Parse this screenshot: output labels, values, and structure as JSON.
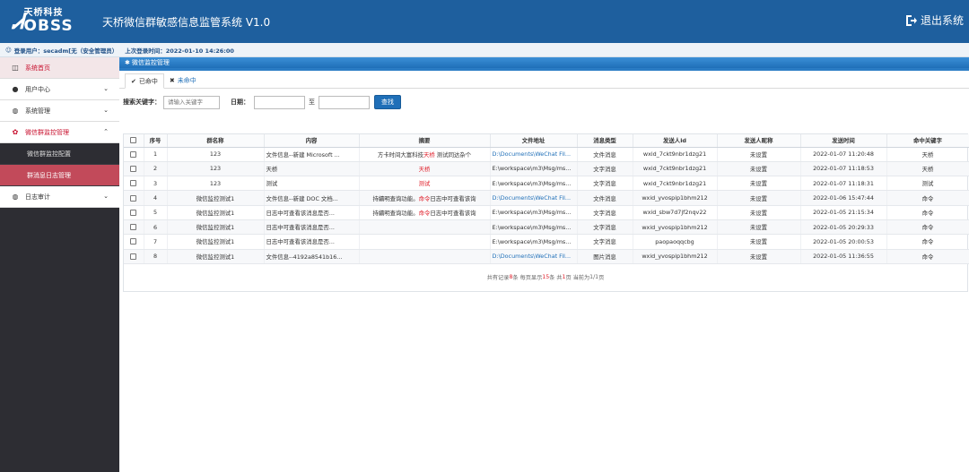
{
  "header": {
    "logo_cn": "天桥科技",
    "logo_en": "OBSS",
    "title": "天桥微信群敏感信息监管系统 V1.0",
    "logout": "退出系统"
  },
  "userbar": {
    "user": "登录用户：secadm[无（安全管理员）",
    "last_login": "上次登录时间：2022-01-10 14:26:00"
  },
  "sidebar": {
    "items": [
      {
        "label": "系统首页",
        "icon": "square-icon"
      },
      {
        "label": "用户中心",
        "icon": "user-icon"
      },
      {
        "label": "系统管理",
        "icon": "globe-icon"
      },
      {
        "label": "微信群监控管理",
        "icon": "gear-icon"
      },
      {
        "label": "日志审计",
        "icon": "globe-icon"
      }
    ],
    "sub_items": [
      {
        "label": "微信群监控配置"
      },
      {
        "label": "群消息日志管理"
      }
    ]
  },
  "panel": {
    "title": "微信监控管理",
    "tabs": [
      "已命中",
      "未命中"
    ]
  },
  "search": {
    "keyword_label": "搜索关键字：",
    "keyword_placeholder": "请输入关键字",
    "date_label": "日期：",
    "to": "至",
    "button": "查找"
  },
  "table": {
    "headers": [
      "序号",
      "群名称",
      "内容",
      "摘要",
      "文件地址",
      "消息类型",
      "发送人id",
      "发送人昵称",
      "发送时间",
      "命中关键字"
    ],
    "rows": [
      {
        "no": "1",
        "group": "123",
        "content": "文件信息--新建 Microsoft ...",
        "summary_pre": "方卡时间大富科技",
        "summary_hl": "天桥",
        "summary_post": " 测试同达杂个",
        "file": "D:\\Documents\\WeChat Fil...",
        "file_link": true,
        "type": "文件消息",
        "sender_id": "wxid_7ckt9nbr1dzg21",
        "nick": "未设置",
        "time": "2022-01-07 11:20:48",
        "keyword": "天桥"
      },
      {
        "no": "2",
        "group": "123",
        "content": "天桥",
        "summary_pre": "",
        "summary_hl": "天桥",
        "summary_post": "",
        "file": "E:\\workspace\\m3\\Msg/ms...",
        "file_link": false,
        "type": "文字消息",
        "sender_id": "wxid_7ckt9nbr1dzg21",
        "nick": "未设置",
        "time": "2022-01-07 11:18:53",
        "keyword": "天桥"
      },
      {
        "no": "3",
        "group": "123",
        "content": "测试",
        "summary_pre": "",
        "summary_hl": "测试",
        "summary_post": "",
        "file": "E:\\workspace\\m3\\Msg/ms...",
        "file_link": false,
        "type": "文字消息",
        "sender_id": "wxid_7ckt9nbr1dzg21",
        "nick": "未设置",
        "time": "2022-01-07 11:18:31",
        "keyword": "测试"
      },
      {
        "no": "4",
        "group": "微信监控测试1",
        "content": "文件信息--新建 DOC 文档...",
        "summary_pre": "持續明查询功能。",
        "summary_hl": "命令",
        "summary_post": "日志中可查看该询",
        "file": "D:\\Documents\\WeChat Fil...",
        "file_link": true,
        "type": "文件消息",
        "sender_id": "wxid_yvospip1bhm212",
        "nick": "未设置",
        "time": "2022-01-06 15:47:44",
        "keyword": "命令"
      },
      {
        "no": "5",
        "group": "微信监控测试1",
        "content": "日志中可查看该消息是否...",
        "summary_pre": "持續明查询功能。",
        "summary_hl": "命令",
        "summary_post": "日志中可查看该询",
        "file": "E:\\workspace\\m3\\Msg/ms...",
        "file_link": false,
        "type": "文字消息",
        "sender_id": "wxid_sbw7d7jf2nqv22",
        "nick": "未设置",
        "time": "2022-01-05 21:15:34",
        "keyword": "命令"
      },
      {
        "no": "6",
        "group": "微信监控测试1",
        "content": "日志中可查看该消息是否...",
        "summary_pre": "",
        "summary_hl": "",
        "summary_post": "",
        "file": "E:\\workspace\\m3\\Msg/ms...",
        "file_link": false,
        "type": "文字消息",
        "sender_id": "wxid_yvospip1bhm212",
        "nick": "未设置",
        "time": "2022-01-05 20:29:33",
        "keyword": "命令"
      },
      {
        "no": "7",
        "group": "微信监控测试1",
        "content": "日志中可查看该消息是否...",
        "summary_pre": "",
        "summary_hl": "",
        "summary_post": "",
        "file": "E:\\workspace\\m3\\Msg/ms...",
        "file_link": false,
        "type": "文字消息",
        "sender_id": "paopaoqqcbg",
        "nick": "未设置",
        "time": "2022-01-05 20:00:53",
        "keyword": "命令"
      },
      {
        "no": "8",
        "group": "微信监控测试1",
        "content": "文件信息--4192a8541b16...",
        "summary_pre": "",
        "summary_hl": "",
        "summary_post": "",
        "file": "D:\\Documents\\WeChat Fil...",
        "file_link": true,
        "type": "图片消息",
        "sender_id": "wxid_yvospip1bhm212",
        "nick": "未设置",
        "time": "2022-01-05 11:36:55",
        "keyword": "命令"
      }
    ]
  },
  "footer": {
    "p1": "共有记录",
    "total": "8",
    "p2": "条 每页显示",
    "per_page": "15",
    "p3": "条 共",
    "pages": "1",
    "p4": "页 当前为 ",
    "current": "1/1",
    "p5": " 页"
  }
}
